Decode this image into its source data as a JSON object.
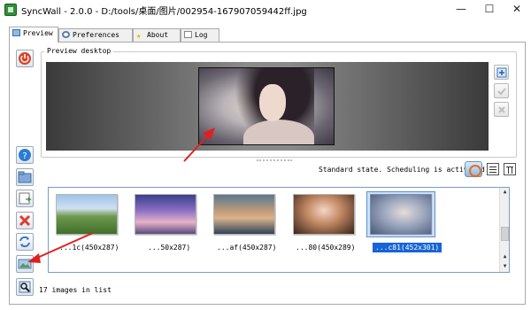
{
  "window": {
    "title": "SyncWall - 2.0.0 - D:/tools/桌面/图片/002954-167907059442ff.jpg",
    "minimize": "—",
    "maximize": "☐",
    "close": "✕"
  },
  "tabs": [
    {
      "label": "Preview",
      "icon": "monitor-icon",
      "active": true
    },
    {
      "label": "Preferences",
      "icon": "gear-icon",
      "active": false
    },
    {
      "label": "About",
      "icon": "star-icon",
      "active": false
    },
    {
      "label": "Log",
      "icon": "notepad-icon",
      "active": false
    }
  ],
  "preview": {
    "group_title": "Preview desktop"
  },
  "status": {
    "text": "Standard state. Scheduling is activated"
  },
  "images": [
    {
      "caption": "...1c(450x287)",
      "selected": false
    },
    {
      "caption": "...50x287)",
      "selected": false
    },
    {
      "caption": "...af(450x287)",
      "selected": false
    },
    {
      "caption": "...80(450x289)",
      "selected": false
    },
    {
      "caption": "...c81(452x301)",
      "selected": true
    }
  ],
  "footer": {
    "count": "17 images in list"
  },
  "colors": {
    "selection": "#1664d6",
    "annotation_arrow": "#e02020",
    "power_button": "#d8432a",
    "delete_button": "#e23b2e"
  }
}
